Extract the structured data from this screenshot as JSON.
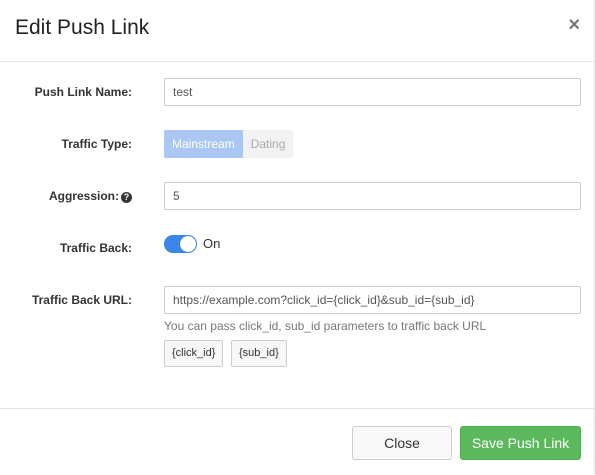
{
  "modal": {
    "title": "Edit Push Link",
    "close_icon": "×"
  },
  "form": {
    "name_label": "Push Link Name:",
    "name_value": "test",
    "traffic_type_label": "Traffic Type:",
    "traffic_type_options": [
      "Mainstream",
      "Dating"
    ],
    "traffic_type_selected": "Mainstream",
    "aggression_label": "Aggression:",
    "aggression_help_icon": "question-circle-icon",
    "aggression_value": "5",
    "traffic_back_label": "Traffic Back:",
    "traffic_back_state": "On",
    "traffic_back_url_label": "Traffic Back URL:",
    "traffic_back_url_value": "https://example.com?click_id={click_id}&sub_id={sub_id}",
    "traffic_back_url_help": "You can pass click_id, sub_id parameters to traffic back URL",
    "param_buttons": [
      "{click_id}",
      "{sub_id}"
    ]
  },
  "footer": {
    "close_label": "Close",
    "save_label": "Save Push Link"
  },
  "colors": {
    "accent": "#3b86e6",
    "segment_active": "#a9c7f2",
    "save": "#5cb85c"
  }
}
